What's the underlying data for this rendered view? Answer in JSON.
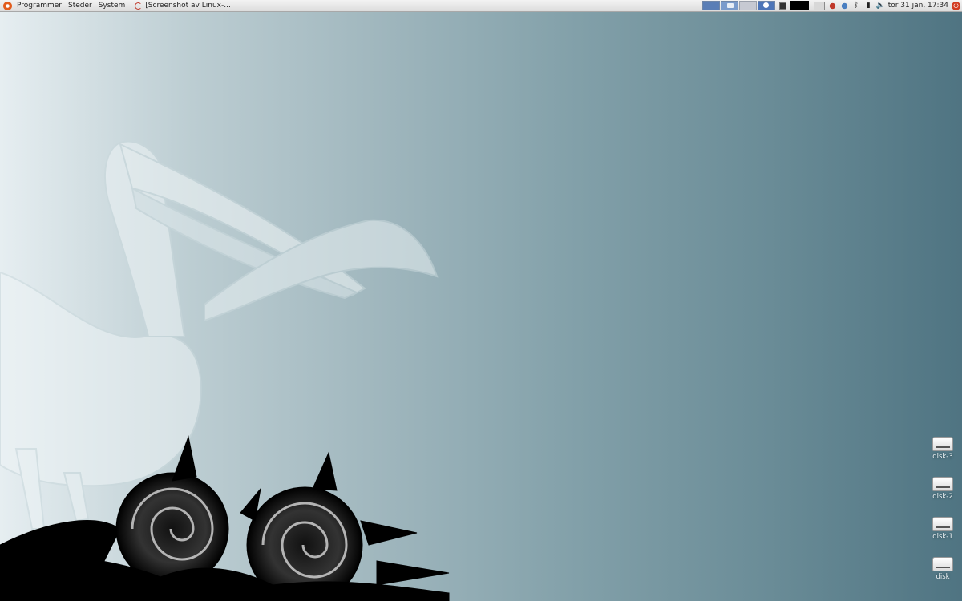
{
  "panel": {
    "menus": [
      {
        "label": "Programmer",
        "name": "applications-menu"
      },
      {
        "label": "Steder",
        "name": "places-menu"
      },
      {
        "label": "System",
        "name": "system-menu"
      }
    ],
    "task": {
      "label": "[Screenshot av Linux-..."
    },
    "clock": "tor 31 jan, 17:34"
  },
  "desktop": {
    "icons": [
      {
        "label": "disk-3"
      },
      {
        "label": "disk-2"
      },
      {
        "label": "disk-1"
      },
      {
        "label": "disk"
      }
    ]
  },
  "colors": {
    "wallpaper_light": "#e6eef1",
    "wallpaper_dark": "#4f7482",
    "panel": "#dcdcdc",
    "accent_red": "#c0392b"
  }
}
